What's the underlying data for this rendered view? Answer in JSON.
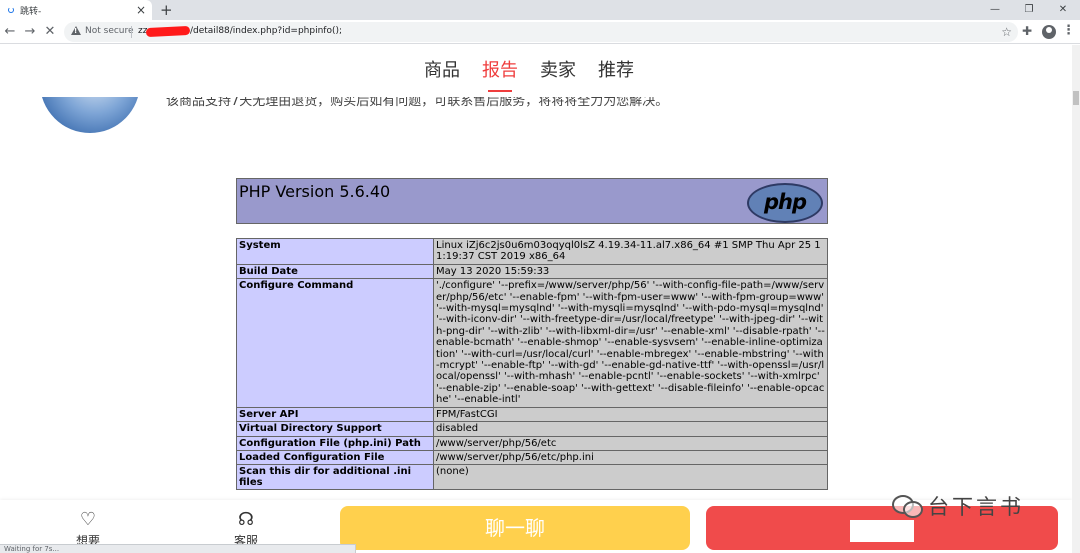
{
  "browser": {
    "tab_title": "跳转-",
    "tab_close": "×",
    "new_tab": "+",
    "window_controls": [
      "—",
      "❐",
      "✕"
    ],
    "back": "←",
    "forward": "→",
    "reload": "✕",
    "security_label": "Not secure",
    "url_prefix": "zz",
    "url_path": "/detail88/index.php?id=phpinfo();",
    "bookmark_icon": "☆",
    "extensions_icon": "puzzle-icon",
    "menu_icon": "⋮"
  },
  "nav": {
    "tabs": [
      {
        "label": "商品",
        "active": false
      },
      {
        "label": "报告",
        "active": true
      },
      {
        "label": "卖家",
        "active": false
      },
      {
        "label": "推荐",
        "active": false
      }
    ]
  },
  "review": {
    "text": "该商品支持7天无理由退货，购买后如有问题，可联系售后服务，将将将全力为您解决。"
  },
  "phpinfo": {
    "version": "PHP Version 5.6.40",
    "logo_text": "php",
    "rows": [
      {
        "key": "System",
        "value": "Linux iZj6c2js0u6m03oqyql0lsZ 4.19.34-11.al7.x86_64 #1 SMP Thu Apr 25 11:19:37 CST 2019 x86_64"
      },
      {
        "key": "Build Date",
        "value": "May 13 2020 15:59:33"
      },
      {
        "key": "Configure Command",
        "value": "'./configure' '--prefix=/www/server/php/56' '--with-config-file-path=/www/server/php/56/etc' '--enable-fpm' '--with-fpm-user=www' '--with-fpm-group=www' '--with-mysql=mysqlnd' '--with-mysqli=mysqlnd' '--with-pdo-mysql=mysqlnd' '--with-iconv-dir' '--with-freetype-dir=/usr/local/freetype' '--with-jpeg-dir' '--with-png-dir' '--with-zlib' '--with-libxml-dir=/usr' '--enable-xml' '--disable-rpath' '--enable-bcmath' '--enable-shmop' '--enable-sysvsem' '--enable-inline-optimization' '--with-curl=/usr/local/curl' '--enable-mbregex' '--enable-mbstring' '--with-mcrypt' '--enable-ftp' '--with-gd' '--enable-gd-native-ttf' '--with-openssl=/usr/local/openssl' '--with-mhash' '--enable-pcntl' '--enable-sockets' '--with-xmlrpc' '--enable-zip' '--enable-soap' '--with-gettext' '--disable-fileinfo' '--enable-opcache' '--enable-intl'"
      },
      {
        "key": "Server API",
        "value": "FPM/FastCGI"
      },
      {
        "key": "Virtual Directory Support",
        "value": "disabled"
      },
      {
        "key": "Configuration File (php.ini) Path",
        "value": "/www/server/php/56/etc"
      },
      {
        "key": "Loaded Configuration File",
        "value": "/www/server/php/56/etc/php.ini"
      },
      {
        "key": "Scan this dir for additional .ini files",
        "value": "(none)"
      }
    ]
  },
  "bottom_bar": {
    "favorite_label": "想要",
    "favorite_icon": "♡",
    "service_label": "客服",
    "chat_button": "聊一聊"
  },
  "status": {
    "text": "Waiting for 7s..."
  },
  "watermark": {
    "text": "台下言书"
  }
}
